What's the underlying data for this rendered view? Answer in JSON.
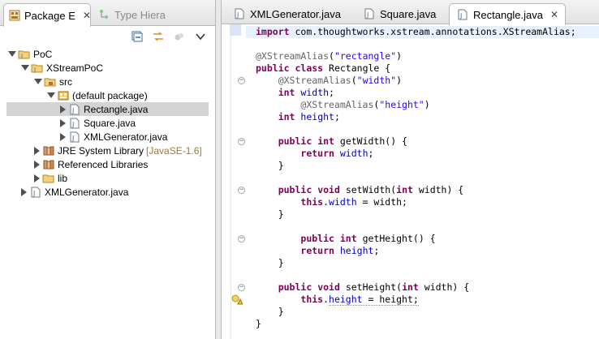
{
  "left_tabs": [
    {
      "label": "Package E",
      "active": true
    },
    {
      "label": "Type Hiera",
      "active": false
    }
  ],
  "tree": [
    {
      "label": "PoC",
      "level": 0,
      "expanded": true,
      "icon": "project-icon"
    },
    {
      "label": "XStreamPoC",
      "level": 1,
      "expanded": true,
      "icon": "project-icon"
    },
    {
      "label": "src",
      "level": 2,
      "expanded": true,
      "icon": "source-folder-icon"
    },
    {
      "label": "(default package)",
      "level": 3,
      "expanded": true,
      "icon": "package-icon"
    },
    {
      "label": "Rectangle.java",
      "level": 4,
      "expanded": false,
      "icon": "java-file-icon",
      "selected": true
    },
    {
      "label": "Square.java",
      "level": 4,
      "expanded": false,
      "icon": "java-file-icon"
    },
    {
      "label": "XMLGenerator.java",
      "level": 4,
      "expanded": false,
      "icon": "java-file-icon"
    },
    {
      "label": "JRE System Library",
      "decor": "[JavaSE-1.6]",
      "level": 2,
      "expanded": false,
      "icon": "library-icon"
    },
    {
      "label": "Referenced Libraries",
      "level": 2,
      "expanded": false,
      "icon": "library-icon"
    },
    {
      "label": "lib",
      "level": 2,
      "expanded": false,
      "icon": "folder-icon"
    },
    {
      "label": "XMLGenerator.java",
      "level": 1,
      "expanded": false,
      "icon": "java-file-icon"
    }
  ],
  "editor_tabs": [
    {
      "label": "XMLGenerator.java",
      "active": false
    },
    {
      "label": "Square.java",
      "active": false
    },
    {
      "label": "Rectangle.java",
      "active": true
    }
  ],
  "code_lines": [
    "import com.thoughtworks.xstream.annotations.XStreamAlias;",
    "",
    "@XStreamAlias(\"rectangle\")",
    "public class Rectangle {",
    "    @XStreamAlias(\"width\")",
    "    int width;",
    "        @XStreamAlias(\"height\")",
    "    int height;",
    "",
    "    public int getWidth() {",
    "        return width;",
    "    }",
    "",
    "    public void setWidth(int width) {",
    "        this.width = width;",
    "    }",
    "",
    "        public int getHeight() {",
    "        return height;",
    "    }",
    "",
    "    public void setHeight(int width) {",
    "        this.height = height;",
    "    }",
    "}"
  ],
  "colors": {
    "keyword": "#7f0055",
    "annotation": "#646464",
    "string": "#2a00ff",
    "field": "#0000c0",
    "current_line": "#e8f2fe",
    "selection": "#d4d4d4"
  }
}
